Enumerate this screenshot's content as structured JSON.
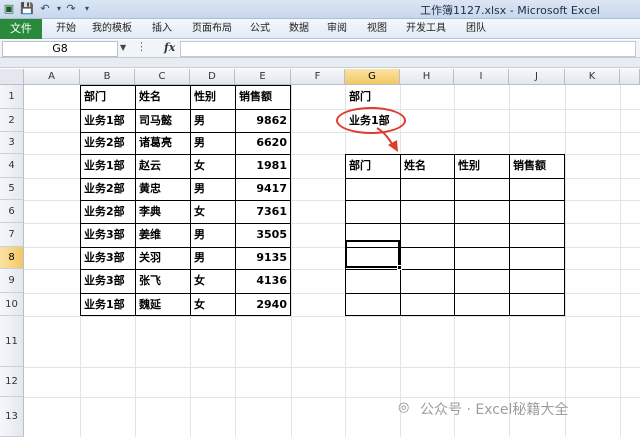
{
  "window": {
    "title": "工作簿1127.xlsx - Microsoft Excel"
  },
  "ribbon": {
    "file_tab": "文件",
    "tabs": [
      "开始",
      "我的模板",
      "插入",
      "页面布局",
      "公式",
      "数据",
      "审阅",
      "视图",
      "开发工具",
      "团队"
    ]
  },
  "formula_bar": {
    "name_box": "G8",
    "fx": "fx",
    "formula": ""
  },
  "columns": [
    "A",
    "B",
    "C",
    "D",
    "E",
    "F",
    "G",
    "H",
    "I",
    "J",
    "K"
  ],
  "rows": [
    "1",
    "2",
    "3",
    "4",
    "5",
    "6",
    "7",
    "8",
    "9",
    "10",
    "11",
    "12",
    "13"
  ],
  "selected": {
    "column": "G",
    "row": "8"
  },
  "source_table": {
    "headers": [
      "部门",
      "姓名",
      "性别",
      "销售额"
    ],
    "rows": [
      [
        "业务1部",
        "司马懿",
        "男",
        "9862"
      ],
      [
        "业务2部",
        "诸葛亮",
        "男",
        "6620"
      ],
      [
        "业务1部",
        "赵云",
        "女",
        "1981"
      ],
      [
        "业务2部",
        "黄忠",
        "男",
        "9417"
      ],
      [
        "业务2部",
        "李典",
        "女",
        "7361"
      ],
      [
        "业务3部",
        "姜维",
        "男",
        "3505"
      ],
      [
        "业务3部",
        "关羽",
        "男",
        "9135"
      ],
      [
        "业务3部",
        "张飞",
        "女",
        "4136"
      ],
      [
        "业务1部",
        "魏延",
        "女",
        "2940"
      ]
    ]
  },
  "criteria": {
    "header": "部门",
    "value": "业务1部"
  },
  "result_table": {
    "headers": [
      "部门",
      "姓名",
      "性别",
      "销售额"
    ]
  },
  "watermark": {
    "text": "公众号 · Excel秘籍大全"
  },
  "colors": {
    "file_tab": "#2a8a3c",
    "highlight": "#e03a2e",
    "selection": "#f3c863"
  }
}
